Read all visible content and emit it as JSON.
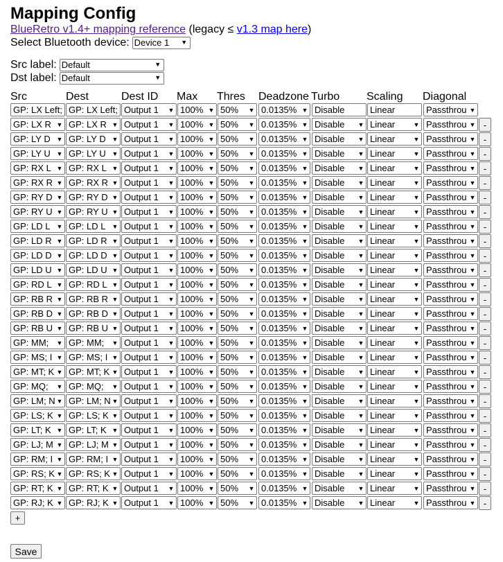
{
  "page": {
    "title": "Mapping Config",
    "ref_link": "BlueRetro v1.4+ mapping reference",
    "legacy_prefix": "(legacy ≤ ",
    "legacy_link": "v1.3 map here",
    "legacy_suffix": ")"
  },
  "device": {
    "label": "Select Bluetooth device:",
    "value": "Device 1"
  },
  "src_label": {
    "label": "Src label:",
    "value": "Default"
  },
  "dst_label": {
    "label": "Dst label:",
    "value": "Default"
  },
  "headers": {
    "src": "Src",
    "dest": "Dest",
    "dest_id": "Dest ID",
    "max": "Max",
    "thres": "Thres",
    "deadzone": "Deadzone",
    "turbo": "Turbo",
    "scaling": "Scaling",
    "diagonal": "Diagonal"
  },
  "rows": [
    {
      "src": "GP: LX Left;",
      "dest": "GP: LX Left;",
      "dest_id": "Output 1",
      "max": "100%",
      "thres": "50%",
      "deadzone": "0.0135%",
      "turbo": "Disable",
      "scaling": "Linear",
      "diagonal": "Passthrou"
    },
    {
      "src": "GP: LX R",
      "dest": "GP: LX R",
      "dest_id": "Output 1",
      "max": "100%",
      "thres": "50%",
      "deadzone": "0.0135%",
      "turbo": "Disable",
      "scaling": "Linear",
      "diagonal": "Passthrou",
      "remove": "-"
    },
    {
      "src": "GP: LY D",
      "dest": "GP: LY D",
      "dest_id": "Output 1",
      "max": "100%",
      "thres": "50%",
      "deadzone": "0.0135%",
      "turbo": "Disable",
      "scaling": "Linear",
      "diagonal": "Passthrou",
      "remove": "-"
    },
    {
      "src": "GP: LY U",
      "dest": "GP: LY U",
      "dest_id": "Output 1",
      "max": "100%",
      "thres": "50%",
      "deadzone": "0.0135%",
      "turbo": "Disable",
      "scaling": "Linear",
      "diagonal": "Passthrou",
      "remove": "-"
    },
    {
      "src": "GP: RX L",
      "dest": "GP: RX L",
      "dest_id": "Output 1",
      "max": "100%",
      "thres": "50%",
      "deadzone": "0.0135%",
      "turbo": "Disable",
      "scaling": "Linear",
      "diagonal": "Passthrou",
      "remove": "-"
    },
    {
      "src": "GP: RX R",
      "dest": "GP: RX R",
      "dest_id": "Output 1",
      "max": "100%",
      "thres": "50%",
      "deadzone": "0.0135%",
      "turbo": "Disable",
      "scaling": "Linear",
      "diagonal": "Passthrou",
      "remove": "-"
    },
    {
      "src": "GP: RY D",
      "dest": "GP: RY D",
      "dest_id": "Output 1",
      "max": "100%",
      "thres": "50%",
      "deadzone": "0.0135%",
      "turbo": "Disable",
      "scaling": "Linear",
      "diagonal": "Passthrou",
      "remove": "-"
    },
    {
      "src": "GP: RY U",
      "dest": "GP: RY U",
      "dest_id": "Output 1",
      "max": "100%",
      "thres": "50%",
      "deadzone": "0.0135%",
      "turbo": "Disable",
      "scaling": "Linear",
      "diagonal": "Passthrou",
      "remove": "-"
    },
    {
      "src": "GP: LD L",
      "dest": "GP: LD L",
      "dest_id": "Output 1",
      "max": "100%",
      "thres": "50%",
      "deadzone": "0.0135%",
      "turbo": "Disable",
      "scaling": "Linear",
      "diagonal": "Passthrou",
      "remove": "-"
    },
    {
      "src": "GP: LD R",
      "dest": "GP: LD R",
      "dest_id": "Output 1",
      "max": "100%",
      "thres": "50%",
      "deadzone": "0.0135%",
      "turbo": "Disable",
      "scaling": "Linear",
      "diagonal": "Passthrou",
      "remove": "-"
    },
    {
      "src": "GP: LD D",
      "dest": "GP: LD D",
      "dest_id": "Output 1",
      "max": "100%",
      "thres": "50%",
      "deadzone": "0.0135%",
      "turbo": "Disable",
      "scaling": "Linear",
      "diagonal": "Passthrou",
      "remove": "-"
    },
    {
      "src": "GP: LD U",
      "dest": "GP: LD U",
      "dest_id": "Output 1",
      "max": "100%",
      "thres": "50%",
      "deadzone": "0.0135%",
      "turbo": "Disable",
      "scaling": "Linear",
      "diagonal": "Passthrou",
      "remove": "-"
    },
    {
      "src": "GP: RD L",
      "dest": "GP: RD L",
      "dest_id": "Output 1",
      "max": "100%",
      "thres": "50%",
      "deadzone": "0.0135%",
      "turbo": "Disable",
      "scaling": "Linear",
      "diagonal": "Passthrou",
      "remove": "-"
    },
    {
      "src": "GP: RB R",
      "dest": "GP: RB R",
      "dest_id": "Output 1",
      "max": "100%",
      "thres": "50%",
      "deadzone": "0.0135%",
      "turbo": "Disable",
      "scaling": "Linear",
      "diagonal": "Passthrou",
      "remove": "-"
    },
    {
      "src": "GP: RB D",
      "dest": "GP: RB D",
      "dest_id": "Output 1",
      "max": "100%",
      "thres": "50%",
      "deadzone": "0.0135%",
      "turbo": "Disable",
      "scaling": "Linear",
      "diagonal": "Passthrou",
      "remove": "-"
    },
    {
      "src": "GP: RB U",
      "dest": "GP: RB U",
      "dest_id": "Output 1",
      "max": "100%",
      "thres": "50%",
      "deadzone": "0.0135%",
      "turbo": "Disable",
      "scaling": "Linear",
      "diagonal": "Passthrou",
      "remove": "-"
    },
    {
      "src": "GP: MM;",
      "dest": "GP: MM;",
      "dest_id": "Output 1",
      "max": "100%",
      "thres": "50%",
      "deadzone": "0.0135%",
      "turbo": "Disable",
      "scaling": "Linear",
      "diagonal": "Passthrou",
      "remove": "-"
    },
    {
      "src": "GP: MS; I",
      "dest": "GP: MS; I",
      "dest_id": "Output 1",
      "max": "100%",
      "thres": "50%",
      "deadzone": "0.0135%",
      "turbo": "Disable",
      "scaling": "Linear",
      "diagonal": "Passthrou",
      "remove": "-"
    },
    {
      "src": "GP: MT; K",
      "dest": "GP: MT; K",
      "dest_id": "Output 1",
      "max": "100%",
      "thres": "50%",
      "deadzone": "0.0135%",
      "turbo": "Disable",
      "scaling": "Linear",
      "diagonal": "Passthrou",
      "remove": "-"
    },
    {
      "src": "GP: MQ;",
      "dest": "GP: MQ;",
      "dest_id": "Output 1",
      "max": "100%",
      "thres": "50%",
      "deadzone": "0.0135%",
      "turbo": "Disable",
      "scaling": "Linear",
      "diagonal": "Passthrou",
      "remove": "-"
    },
    {
      "src": "GP: LM; N",
      "dest": "GP: LM; N",
      "dest_id": "Output 1",
      "max": "100%",
      "thres": "50%",
      "deadzone": "0.0135%",
      "turbo": "Disable",
      "scaling": "Linear",
      "diagonal": "Passthrou",
      "remove": "-"
    },
    {
      "src": "GP: LS; K",
      "dest": "GP: LS; K",
      "dest_id": "Output 1",
      "max": "100%",
      "thres": "50%",
      "deadzone": "0.0135%",
      "turbo": "Disable",
      "scaling": "Linear",
      "diagonal": "Passthrou",
      "remove": "-"
    },
    {
      "src": "GP: LT; K",
      "dest": "GP: LT; K",
      "dest_id": "Output 1",
      "max": "100%",
      "thres": "50%",
      "deadzone": "0.0135%",
      "turbo": "Disable",
      "scaling": "Linear",
      "diagonal": "Passthrou",
      "remove": "-"
    },
    {
      "src": "GP: LJ; M",
      "dest": "GP: LJ; M",
      "dest_id": "Output 1",
      "max": "100%",
      "thres": "50%",
      "deadzone": "0.0135%",
      "turbo": "Disable",
      "scaling": "Linear",
      "diagonal": "Passthrou",
      "remove": "-"
    },
    {
      "src": "GP: RM; I",
      "dest": "GP: RM; I",
      "dest_id": "Output 1",
      "max": "100%",
      "thres": "50%",
      "deadzone": "0.0135%",
      "turbo": "Disable",
      "scaling": "Linear",
      "diagonal": "Passthrou",
      "remove": "-"
    },
    {
      "src": "GP: RS; K",
      "dest": "GP: RS; K",
      "dest_id": "Output 1",
      "max": "100%",
      "thres": "50%",
      "deadzone": "0.0135%",
      "turbo": "Disable",
      "scaling": "Linear",
      "diagonal": "Passthrou",
      "remove": "-"
    },
    {
      "src": "GP: RT; K",
      "dest": "GP: RT; K",
      "dest_id": "Output 1",
      "max": "100%",
      "thres": "50%",
      "deadzone": "0.0135%",
      "turbo": "Disable",
      "scaling": "Linear",
      "diagonal": "Passthrou",
      "remove": "-"
    },
    {
      "src": "GP: RJ; K",
      "dest": "GP: RJ; K",
      "dest_id": "Output 1",
      "max": "100%",
      "thres": "50%",
      "deadzone": "0.0135%",
      "turbo": "Disable",
      "scaling": "Linear",
      "diagonal": "Passthrou",
      "remove": "-"
    }
  ],
  "buttons": {
    "add": "+",
    "save": "Save"
  },
  "icons": {
    "dropdown": "chevron-down-icon"
  }
}
